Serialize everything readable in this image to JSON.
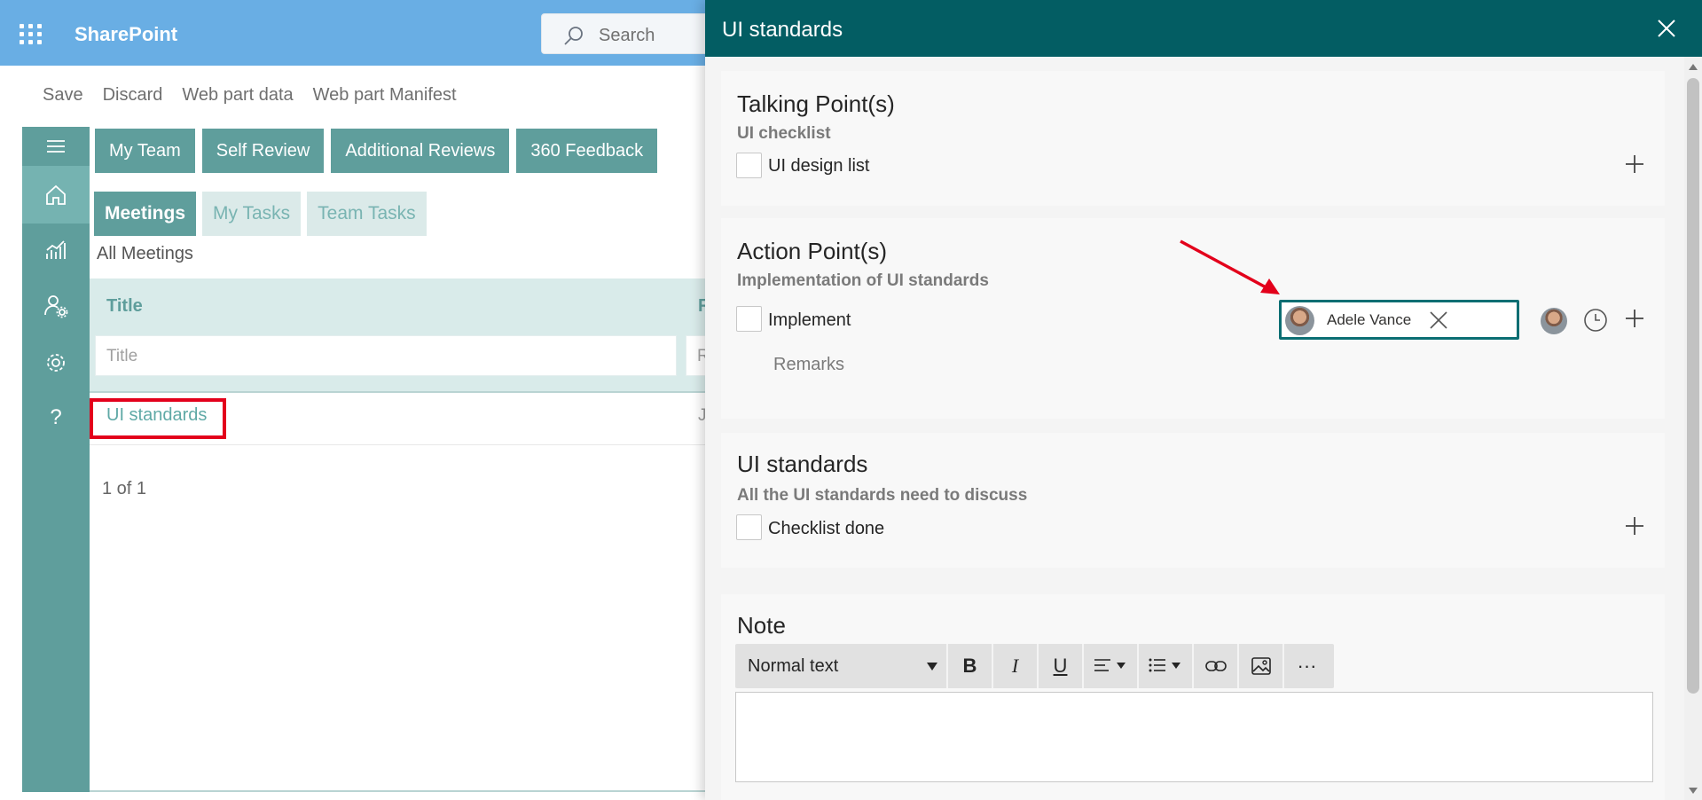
{
  "suite": {
    "brand": "SharePoint",
    "search_placeholder": "Search"
  },
  "command_bar": {
    "save": "Save",
    "discard": "Discard",
    "web_part_data": "Web part data",
    "web_part_manifest": "Web part Manifest"
  },
  "rail": {
    "icons": [
      "menu-icon",
      "home-icon",
      "chart-icon",
      "person-settings-icon",
      "gear-icon",
      "help-icon"
    ],
    "help_label": "?"
  },
  "top_nav": [
    "My Team",
    "Self Review",
    "Additional Reviews",
    "360 Feedback"
  ],
  "sub_tabs": {
    "meetings": "Meetings",
    "my_tasks": "My Tasks",
    "team_tasks": "Team Tasks"
  },
  "list": {
    "heading": "All Meetings",
    "columns": {
      "title": "Title",
      "second_initial": "R"
    },
    "filters": {
      "title_placeholder": "Title",
      "second_placeholder": "R"
    },
    "rows": [
      {
        "title": "UI standards",
        "second_initial": "J"
      }
    ],
    "pager": "1 of 1"
  },
  "panel": {
    "title": "UI standards",
    "talking_points": {
      "title": "Talking Point(s)",
      "subtitle": "UI checklist",
      "items": [
        "UI design list"
      ]
    },
    "action_points": {
      "title": "Action Point(s)",
      "subtitle": "Implementation of UI standards",
      "items": [
        "Implement"
      ],
      "assignee": "Adele Vance",
      "remarks_placeholder": "Remarks"
    },
    "ui_standards": {
      "title": "UI standards",
      "subtitle": "All the UI standards need to discuss",
      "items": [
        "Checklist done"
      ]
    },
    "note": {
      "title": "Note",
      "toolbar": {
        "style": "Normal text",
        "bold": "B",
        "italic": "I",
        "underline": "U",
        "more": "···"
      }
    }
  },
  "colors": {
    "suite": "#69aee4",
    "teal": "#5f9e9c",
    "panel_header": "#035d63",
    "highlight": "#e3001b"
  }
}
